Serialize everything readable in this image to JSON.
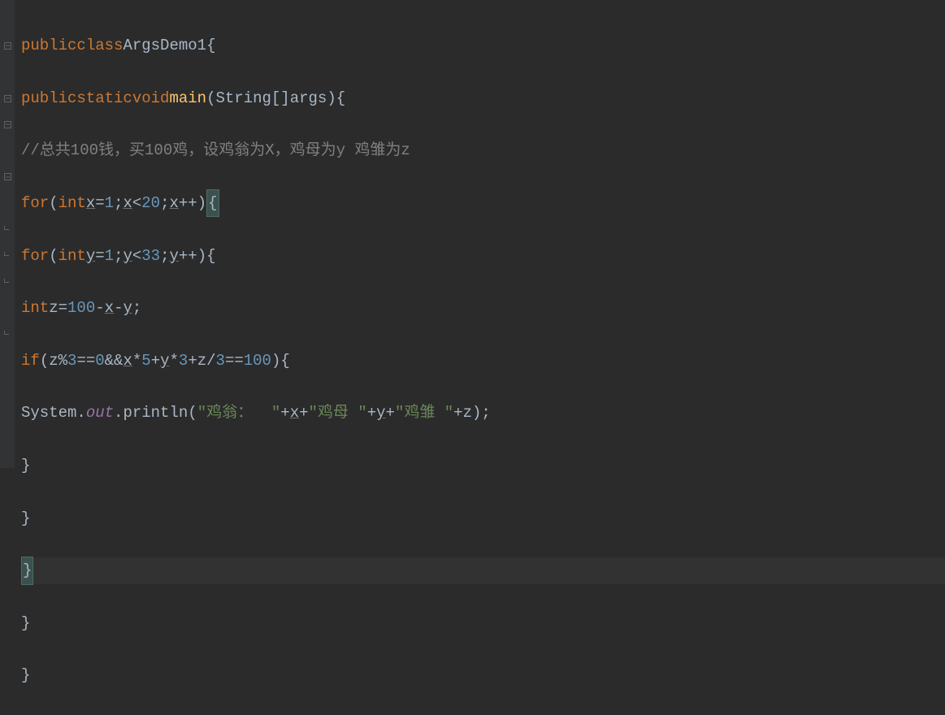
{
  "code": {
    "line1": {
      "kw_public": "public",
      "kw_class": "class",
      "class_name": "ArgsDemo1",
      "brace": "{"
    },
    "line2": {
      "kw_public": "public",
      "kw_static": "static",
      "kw_void": "void",
      "method": "main",
      "param_type": "String",
      "brackets": "[]",
      "param_name": "args",
      "close_paren": ")",
      "brace": "{"
    },
    "line3": {
      "comment": "//总共100钱，买100鸡，设鸡翁为X，鸡母为y 鸡雏为z"
    },
    "line4": {
      "kw_for": "for",
      "open": "(",
      "kw_int": "int",
      "var_x": "x",
      "eq": "=",
      "num1": "1",
      "semi1": ";",
      "var_x2": "x",
      "lt": "<",
      "num20": "20",
      "semi2": ";",
      "var_x3": "x",
      "inc": "++",
      "close": ")",
      "brace": "{"
    },
    "line5": {
      "kw_for": "for",
      "open": "(",
      "kw_int": "int",
      "var_y": "y",
      "eq": "=",
      "num1": "1",
      "semi1": ";",
      "var_y2": "y",
      "lt": "<",
      "num33": "33",
      "semi2": ";",
      "var_y3": "y",
      "inc": "++",
      "close": ")",
      "brace": "{"
    },
    "line6": {
      "kw_int": "int",
      "var_z": "z",
      "eq": "=",
      "num100": "100",
      "minus1": "-",
      "var_x": "x",
      "minus2": "-",
      "var_y": "y",
      "semi": ";"
    },
    "line7": {
      "kw_if": "if",
      "open": "(",
      "var_z1": "z",
      "mod": "%",
      "num3a": "3",
      "eqeq1": "==",
      "num0": "0",
      "and": "&&",
      "var_x": "x",
      "mul1": "*",
      "num5": "5",
      "plus1": "+",
      "var_y": "y",
      "mul2": "*",
      "num3b": "3",
      "plus2": "+",
      "var_z2": "z",
      "div": "/",
      "num3c": "3",
      "eqeq2": "==",
      "num100": "100",
      "close": ")",
      "brace": "{"
    },
    "line8": {
      "sys": "System",
      "dot1": ".",
      "out": "out",
      "dot2": ".",
      "println": "println",
      "open": "(",
      "str1": "\"鸡翁：  \"",
      "plus1": "+",
      "var_x": "x",
      "plus2": "+",
      "str2": "\"鸡母 \"",
      "plus3": "+",
      "var_y": "y",
      "plus4": "+",
      "str3": "\"鸡雏 \"",
      "plus5": "+",
      "var_z": "z",
      "close": ")",
      "semi": ";"
    },
    "line9": {
      "brace": "}"
    },
    "line10": {
      "brace": "}"
    },
    "line11": {
      "brace": "}"
    },
    "line12": {
      "brace": "}"
    },
    "line13": {
      "brace": "}"
    }
  }
}
